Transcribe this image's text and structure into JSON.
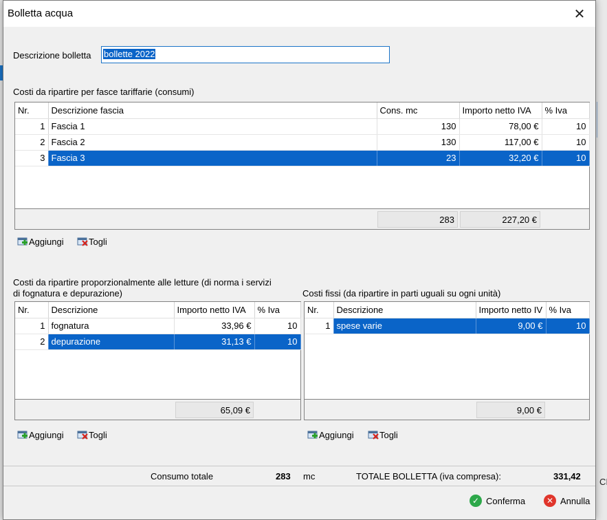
{
  "background": {
    "right_fragment": "CI"
  },
  "window": {
    "title": "Bolletta acqua",
    "close_glyph": "✕"
  },
  "description": {
    "label": "Descrizione bolletta",
    "value": "bollette 2022"
  },
  "fasce": {
    "section_label": "Costi da ripartire per fasce tariffarie (consumi)",
    "columns": [
      "Nr.",
      "Descrizione fascia",
      "Cons. mc",
      "Importo netto IVA",
      "% Iva"
    ],
    "rows": [
      {
        "nr": "1",
        "desc": "Fascia 1",
        "cons": "130",
        "importo": "78,00 €",
        "iva": "10"
      },
      {
        "nr": "2",
        "desc": "Fascia 2",
        "cons": "130",
        "importo": "117,00 €",
        "iva": "10"
      },
      {
        "nr": "3",
        "desc": "Fascia 3",
        "cons": "23",
        "importo": "32,20 €",
        "iva": "10"
      }
    ],
    "selected_row": 3,
    "total_cons": "283",
    "total_importo": "227,20 €",
    "add_label": "Aggiungi",
    "remove_label": "Togli"
  },
  "proporzionali": {
    "section_label_line1": "Costi da ripartire proporzionalmente alle letture (di norma i servizi",
    "section_label_line2": "di fognatura e depurazione)",
    "columns": [
      "Nr.",
      "Descrizione",
      "Importo netto IVA",
      "% Iva"
    ],
    "rows": [
      {
        "nr": "1",
        "desc": "fognatura",
        "importo": "33,96 €",
        "iva": "10"
      },
      {
        "nr": "2",
        "desc": "depurazione",
        "importo": "31,13 €",
        "iva": "10"
      }
    ],
    "selected_row": 2,
    "total_importo": "65,09 €",
    "add_label": "Aggiungi",
    "remove_label": "Togli"
  },
  "fissi": {
    "section_label": "Costi fissi (da ripartire in parti uguali su ogni unità)",
    "columns": [
      "Nr.",
      "Descrizione",
      "Importo netto IV",
      "% Iva"
    ],
    "rows": [
      {
        "nr": "1",
        "desc": "spese varie",
        "importo": "9,00 €",
        "iva": "10"
      }
    ],
    "selected_row": 1,
    "total_importo": "9,00 €",
    "add_label": "Aggiungi",
    "remove_label": "Togli"
  },
  "summary": {
    "consumo_label": "Consumo totale",
    "consumo_value": "283",
    "consumo_unit": "mc",
    "totale_label": "TOTALE BOLLETTA (iva compresa):",
    "totale_value": "331,42"
  },
  "buttons": {
    "confirm": "Conferma",
    "cancel": "Annulla"
  },
  "colors": {
    "selection": "#0a64c8",
    "confirm": "#2da84a",
    "cancel": "#e0352b"
  }
}
